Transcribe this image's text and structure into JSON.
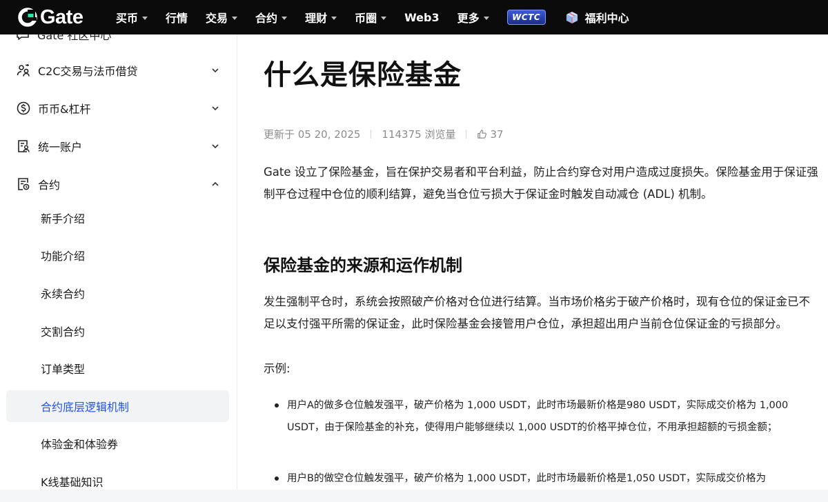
{
  "nav": {
    "logo_text": "Gate",
    "items": [
      {
        "label": "买币",
        "dropdown": true
      },
      {
        "label": "行情",
        "dropdown": false
      },
      {
        "label": "交易",
        "dropdown": true
      },
      {
        "label": "合约",
        "dropdown": true
      },
      {
        "label": "理财",
        "dropdown": true
      },
      {
        "label": "币圈",
        "dropdown": true
      },
      {
        "label": "Web3",
        "dropdown": false
      },
      {
        "label": "更多",
        "dropdown": true
      }
    ],
    "badge_text": "WCTC",
    "gift_label": "福利中心"
  },
  "sidebar": {
    "clipped_label": "Gate 社区中心",
    "sections": [
      {
        "label": "C2C交易与法币借贷",
        "icon": "people-icon",
        "expanded": false
      },
      {
        "label": "币币&杠杆",
        "icon": "coin-icon",
        "expanded": false
      },
      {
        "label": "统一账户",
        "icon": "account-icon",
        "expanded": false
      },
      {
        "label": "合约",
        "icon": "contract-icon",
        "expanded": true
      }
    ],
    "sub_items": [
      {
        "label": "新手介绍",
        "active": false
      },
      {
        "label": "功能介绍",
        "active": false
      },
      {
        "label": "永续合约",
        "active": false
      },
      {
        "label": "交割合约",
        "active": false
      },
      {
        "label": "订单类型",
        "active": false
      },
      {
        "label": "合约底层逻辑机制",
        "active": true
      },
      {
        "label": "体验金和体验券",
        "active": false
      },
      {
        "label": "K线基础知识",
        "active": false
      }
    ]
  },
  "article": {
    "title": "什么是保险基金",
    "updated": "更新于 05 20, 2025",
    "views": "114375 浏览量",
    "likes": "37",
    "intro": "Gate 设立了保险基金，旨在保护交易者和平台利益，防止合约穿仓对用户造成过度损失。保险基金用于保证强制平仓过程中仓位的顺利结算，避免当仓位亏损大于保证金时触发自动减仓 (ADL) 机制。",
    "section_title": "保险基金的来源和运作机制",
    "section_body": "发生强制平仓时，系统会按照破产价格对仓位进行结算。当市场价格劣于破产价格时，现有仓位的保证金已不足以支付强平所需的保证金，此时保险基金会接管用户仓位，承担超出用户当前仓位保证金的亏损部分。",
    "example_label": "示例:",
    "bullets": [
      "用户A的做多仓位触发强平，破产价格为 1,000 USDT，此时市场最新价格是980 USDT，实际成交价格为 1,000 USDT，由于保险基金的补充，使得用户能够继续以 1,000 USDT的价格平掉仓位，不用承担超额的亏损金额；",
      "用户B的做空仓位触发强平，破产价格为 1,000 USDT，此时市场最新价格是1,050 USDT，实际成交价格为"
    ]
  },
  "colors": {
    "accent": "#2354e6",
    "topbar": "#0b0b0b",
    "muted": "#8c8c8c"
  }
}
